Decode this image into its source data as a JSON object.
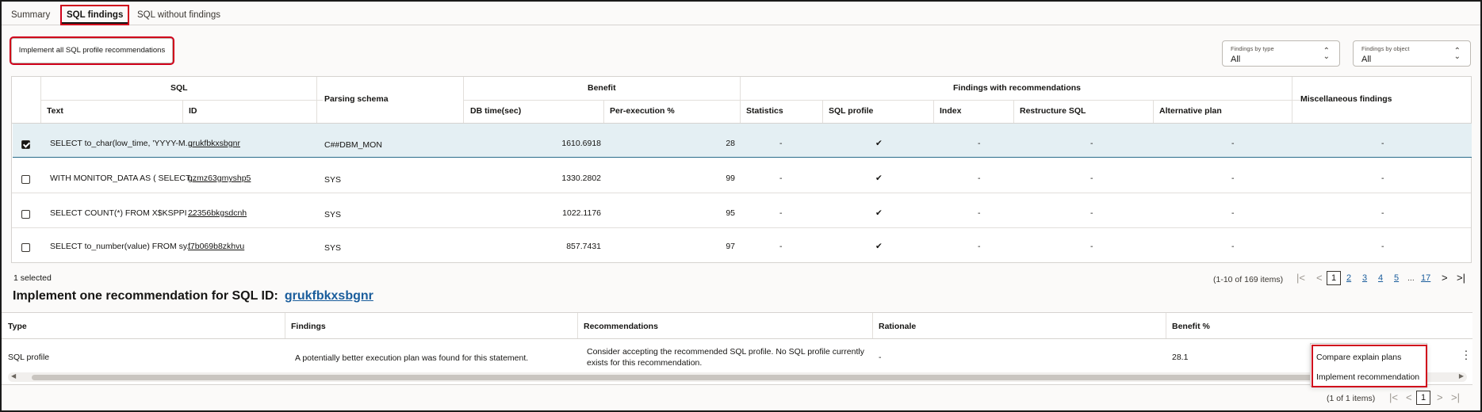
{
  "tabs": [
    "Summary",
    "SQL findings",
    "SQL without findings"
  ],
  "toolbar": {
    "implement_all": "Implement all SQL profile recommendations",
    "filter_type": {
      "label": "Findings by type",
      "value": "All"
    },
    "filter_object": {
      "label": "Findings by object",
      "value": "All"
    }
  },
  "table": {
    "group_headers": {
      "sql": "SQL",
      "parsing_schema": "Parsing schema",
      "benefit": "Benefit",
      "findings": "Findings with recommendations",
      "misc": "Miscellaneous findings"
    },
    "columns": {
      "text": "Text",
      "id": "ID",
      "db_time": "DB time(sec)",
      "per_exec": "Per-execution %",
      "statistics": "Statistics",
      "sql_profile": "SQL profile",
      "index": "Index",
      "restructure": "Restructure SQL",
      "alt_plan": "Alternative plan"
    },
    "rows": [
      {
        "checked": true,
        "text": "SELECT to_char(low_time, 'YYYY-M...",
        "id": "grukfbkxsbgnr",
        "schema": "C##DBM_MON",
        "db_time": "1610.6918",
        "per_exec": "28",
        "statistics": "-",
        "sql_profile": "✔",
        "index": "-",
        "restructure": "-",
        "alt_plan": "-",
        "misc": "-"
      },
      {
        "checked": false,
        "text": "WITH MONITOR_DATA AS ( SELECT...",
        "id": "gzmz63gmyshp5",
        "schema": "SYS",
        "db_time": "1330.2802",
        "per_exec": "99",
        "statistics": "-",
        "sql_profile": "✔",
        "index": "-",
        "restructure": "-",
        "alt_plan": "-",
        "misc": "-"
      },
      {
        "checked": false,
        "text": "SELECT COUNT(*) FROM X$KSPPI ...",
        "id": "22356bkgsdcnh",
        "schema": "SYS",
        "db_time": "1022.1176",
        "per_exec": "95",
        "statistics": "-",
        "sql_profile": "✔",
        "index": "-",
        "restructure": "-",
        "alt_plan": "-",
        "misc": "-"
      },
      {
        "checked": false,
        "text": "SELECT to_number(value) FROM sy...",
        "id": "f7b069b8zkhvu",
        "schema": "SYS",
        "db_time": "857.7431",
        "per_exec": "97",
        "statistics": "-",
        "sql_profile": "✔",
        "index": "-",
        "restructure": "-",
        "alt_plan": "-",
        "misc": "-"
      }
    ],
    "selected_count": "1 selected",
    "range": "(1-10 of 169 items)",
    "pages": [
      "1",
      "2",
      "3",
      "4",
      "5",
      "...",
      "17"
    ]
  },
  "detail": {
    "title": "Implement one recommendation for SQL ID:",
    "sql_id": "grukfbkxsbgnr",
    "columns": {
      "type": "Type",
      "findings": "Findings",
      "recommendations": "Recommendations",
      "rationale": "Rationale",
      "benefit": "Benefit %"
    },
    "row": {
      "type": "SQL profile",
      "findings": "A potentially better execution plan was found for this statement.",
      "rec_line1": "Consider accepting the recommended SQL profile. No SQL profile currently",
      "rec_line2": "exists for this recommendation.",
      "rationale": "-",
      "benefit": "28.1"
    },
    "menu": {
      "compare": "Compare explain plans",
      "implement": "Implement recommendation"
    },
    "range": "(1 of 1 items)",
    "page": "1"
  }
}
